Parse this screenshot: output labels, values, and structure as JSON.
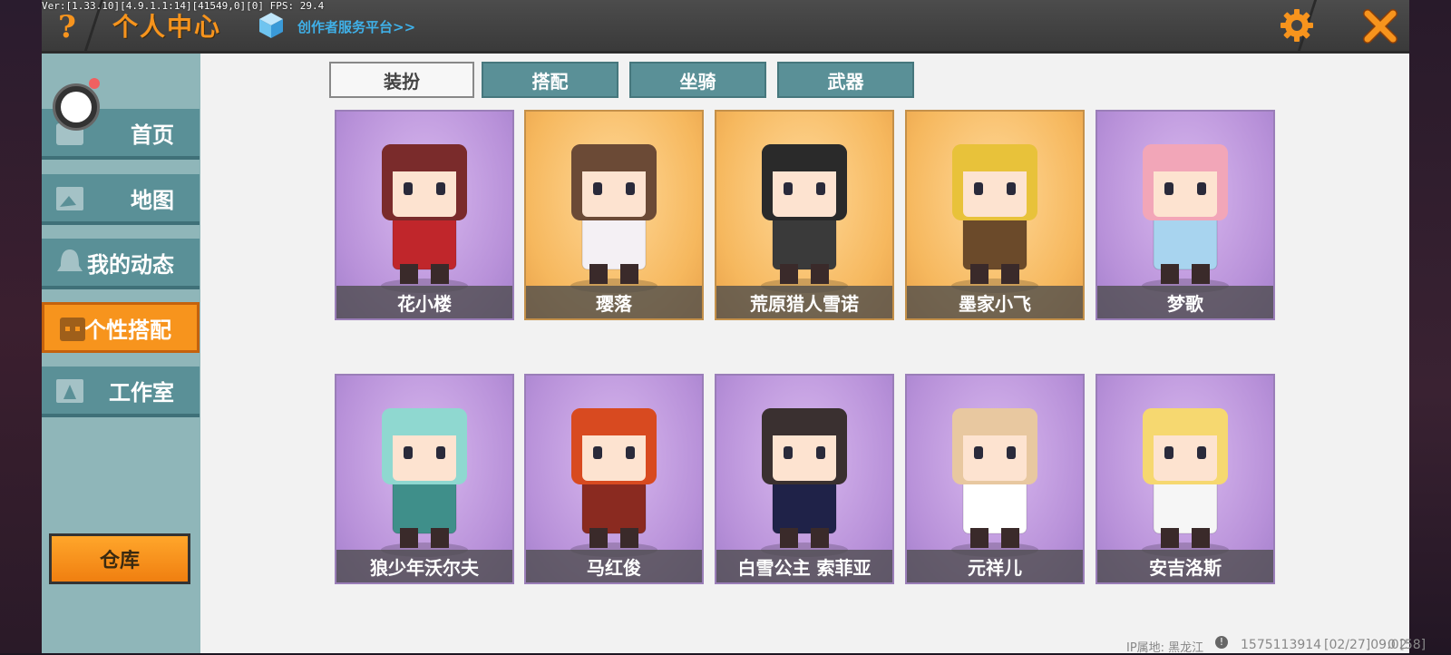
{
  "debug": "Ver:[1.33.10][4.9.1.1:14][41549,0][0] FPS: 29.4",
  "header": {
    "help": "?",
    "title": "个人中心",
    "creator_link": "创作者服务平台>>",
    "gear_icon": "gear-icon",
    "close_icon": "close-icon"
  },
  "sidebar": {
    "items": [
      {
        "label": "首页",
        "icon": "home-icon"
      },
      {
        "label": "地图",
        "icon": "map-icon"
      },
      {
        "label": "我的动态",
        "icon": "bell-icon"
      },
      {
        "label": "个性搭配",
        "icon": "character-icon",
        "active": true
      },
      {
        "label": "工作室",
        "icon": "studio-icon"
      }
    ],
    "warehouse": "仓库"
  },
  "tabs": [
    {
      "label": "装扮",
      "active": true
    },
    {
      "label": "搭配",
      "active": false
    },
    {
      "label": "坐骑",
      "active": false
    },
    {
      "label": "武器",
      "active": false
    }
  ],
  "cards": [
    {
      "name": "花小楼",
      "bg": "purple",
      "hair": "#7a2b2b",
      "outfit": "#c0262b"
    },
    {
      "name": "璎落",
      "bg": "gold",
      "hair": "#6b4a36",
      "outfit": "#f4f0f4"
    },
    {
      "name": "荒原猎人雪诺",
      "bg": "gold",
      "hair": "#2a2a2a",
      "outfit": "#3a3a3a"
    },
    {
      "name": "墨家小飞",
      "bg": "gold",
      "hair": "#e8c23a",
      "outfit": "#6b4a2a"
    },
    {
      "name": "梦歌",
      "bg": "purple",
      "hair": "#f2a6b8",
      "outfit": "#a8d4ef"
    },
    {
      "name": "狼少年沃尔夫",
      "bg": "purple",
      "hair": "#8fd8d0",
      "outfit": "#3f8f8a"
    },
    {
      "name": "马红俊",
      "bg": "purple",
      "hair": "#d84a20",
      "outfit": "#8a2a20"
    },
    {
      "name": "白雪公主 索菲亚",
      "bg": "purple",
      "hair": "#3a3030",
      "outfit": "#1f2248"
    },
    {
      "name": "元祥儿",
      "bg": "purple",
      "hair": "#e8c8a0",
      "outfit": "#ffffff"
    },
    {
      "name": "安吉洛斯",
      "bg": "purple",
      "hair": "#f6d870",
      "outfit": "#f6f6f6"
    }
  ],
  "footer": {
    "ip": "IP属地: 黑龙江",
    "uid": "1575113914",
    "time": "[02/27]09:02",
    "extra": "0 [58]"
  },
  "colors": {
    "accent": "#f7941d",
    "teal": "#5a9097",
    "link": "#3fb0e8"
  }
}
